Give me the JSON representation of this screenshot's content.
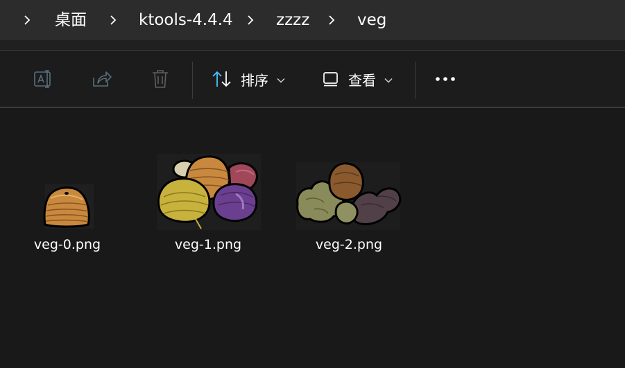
{
  "breadcrumb": {
    "items": [
      {
        "label": "桌面"
      },
      {
        "label": "ktools-4.4.4"
      },
      {
        "label": "zzzz"
      },
      {
        "label": "veg"
      }
    ]
  },
  "toolbar": {
    "rename_icon": "rename-icon",
    "share_icon": "share-icon",
    "delete_icon": "delete-icon",
    "sort_label": "排序",
    "view_label": "查看",
    "more_icon": "more-icon"
  },
  "files": [
    {
      "name": "veg-0.png"
    },
    {
      "name": "veg-1.png"
    },
    {
      "name": "veg-2.png"
    }
  ],
  "colors": {
    "accent": "#4cc2ff",
    "background": "#191919",
    "address_bar": "#2c2c2c"
  }
}
